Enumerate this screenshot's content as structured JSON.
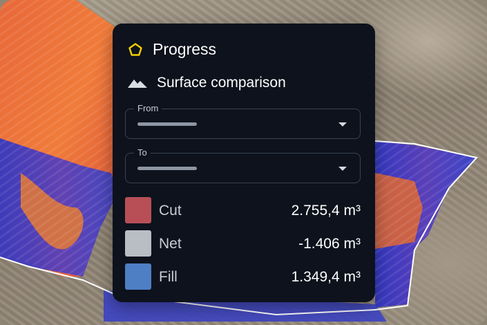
{
  "panel": {
    "title": "Progress",
    "subtitle": "Surface comparison",
    "from_label": "From",
    "to_label": "To",
    "legend": [
      {
        "label": "Cut",
        "value": "2.755,4 m³",
        "color": "#b84f57"
      },
      {
        "label": "Net",
        "value": "-1.406 m³",
        "color": "#b9bdc4"
      },
      {
        "label": "Fill",
        "value": "1.349,4 m³",
        "color": "#4e7ec4"
      }
    ]
  },
  "colors": {
    "panel_bg": "#0d121c",
    "accent": "#f5d000",
    "cut": "#e04a3a",
    "fill": "#3d3fc8"
  },
  "icons": {
    "title_icon": "pentagon-icon",
    "subtitle_icon": "mountain-icon",
    "dropdown_icon": "caret-down-icon"
  }
}
